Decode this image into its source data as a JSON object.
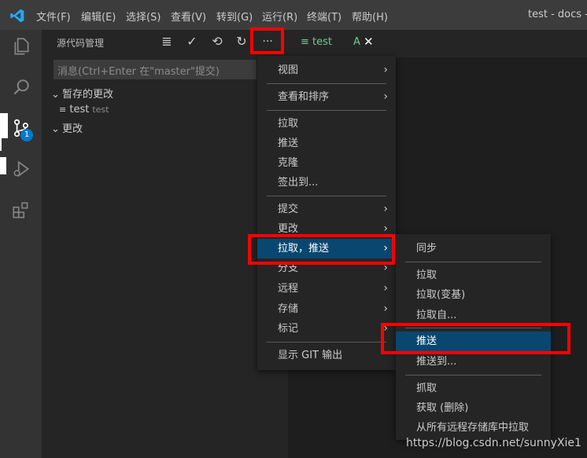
{
  "titlebar": {
    "menus": [
      "文件(F)",
      "编辑(E)",
      "选择(S)",
      "查看(V)",
      "转到(G)",
      "运行(R)",
      "终端(T)",
      "帮助(H)"
    ],
    "window_title": "test - docs - Vi"
  },
  "activitybar": {
    "icons": [
      "explorer-icon",
      "search-icon",
      "source-control-icon",
      "run-debug-icon",
      "extensions-icon"
    ],
    "scm_badge": "1"
  },
  "sidebar": {
    "title": "源代码管理",
    "actions": [
      "≣",
      "✓",
      "⟲",
      "↻",
      "···"
    ],
    "message_placeholder": "消息(Ctrl+Enter 在\"master\"提交)",
    "staged_group": "暂存的更改",
    "staged_file_name": "test",
    "staged_file_path": "test",
    "changes_group": "更改"
  },
  "tabs": {
    "tab1_label": "test",
    "tab2_label": "A"
  },
  "main_menu": {
    "items": [
      "视图",
      "查看和排序",
      "拉取",
      "推送",
      "克隆",
      "签出到...",
      "提交",
      "更改",
      "拉取，推送",
      "分支",
      "远程",
      "存储",
      "标记",
      "显示 GIT 输出"
    ]
  },
  "sub_menu": {
    "items": [
      "同步",
      "拉取",
      "拉取(变基)",
      "拉取自...",
      "推送",
      "推送到...",
      "抓取",
      "获取 (删除)",
      "从所有远程存储库中拉取"
    ]
  },
  "watermark": "https://blog.csdn.net/sunnyXie1",
  "colors": {
    "titlebar": "#3c3c3c",
    "activitybar": "#333333",
    "sidebar": "#252526",
    "editor": "#1e1e1e",
    "selection": "#094771",
    "highlight_box": "#ff0000",
    "accent": "#007acc"
  }
}
